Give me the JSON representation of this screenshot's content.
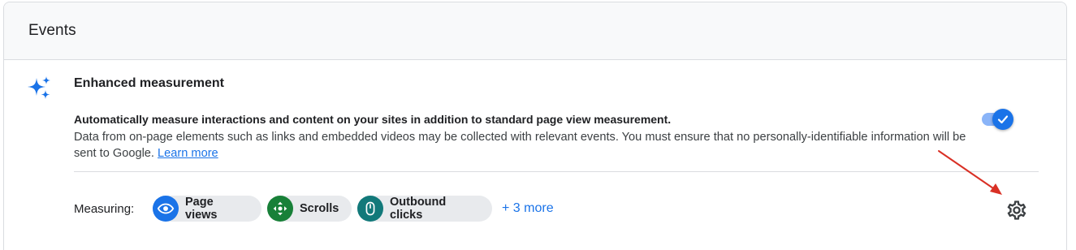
{
  "card": {
    "title": "Events"
  },
  "enhanced": {
    "icon": "sparkle-icon",
    "title": "Enhanced measurement",
    "lead": "Automatically measure interactions and content on your sites in addition to standard page view measurement.",
    "body": "Data from on-page elements such as links and embedded videos may be collected with relevant events. You must ensure that no personally-identifiable information will be sent to Google.",
    "learn_more": "Learn more",
    "toggle_on": true
  },
  "measuring": {
    "label": "Measuring:",
    "chips": [
      {
        "label": "Page views",
        "icon": "eye-icon",
        "color": "#1a73e8"
      },
      {
        "label": "Scrolls",
        "icon": "scroll-arrows-icon",
        "color": "#188038"
      },
      {
        "label": "Outbound clicks",
        "icon": "mouse-icon",
        "color": "#12797a"
      }
    ],
    "more": "+ 3 more",
    "settings_icon": "gear-icon"
  },
  "annotation": {
    "arrow_color": "#d93025"
  },
  "colors": {
    "accent": "#1a73e8",
    "toggle_track": "#8ab4f8"
  }
}
